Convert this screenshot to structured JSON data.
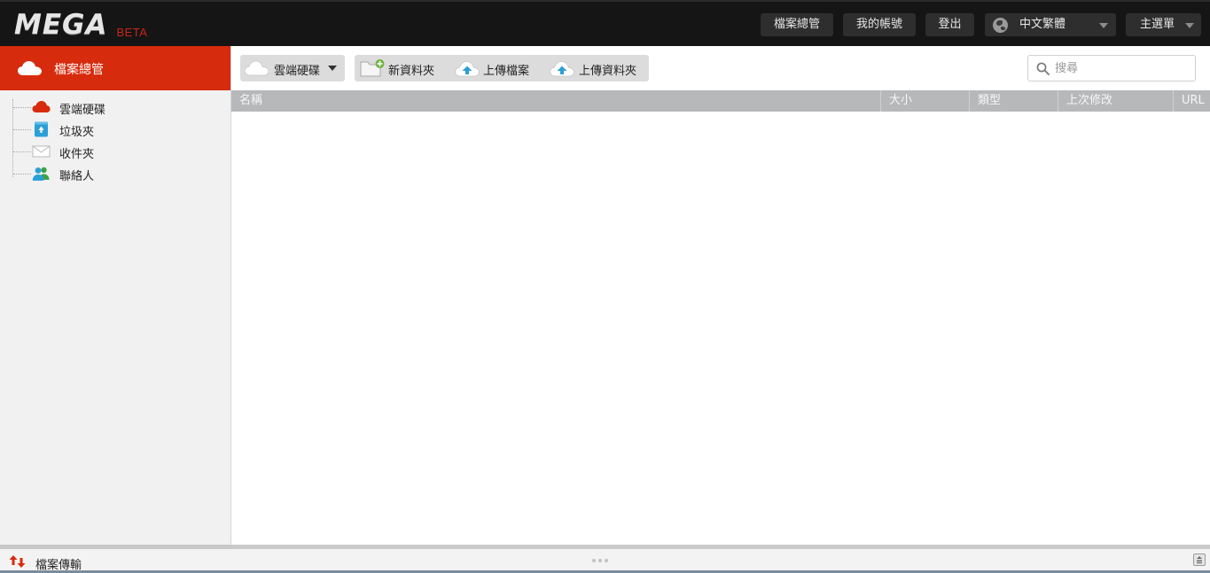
{
  "topbar": {
    "logo_text": "MEGA",
    "beta_label": "BETA",
    "file_manager_label": "檔案總管",
    "my_account_label": "我的帳號",
    "logout_label": "登出",
    "language_label": "中文繁體",
    "main_menu_label": "主選單"
  },
  "sidebar": {
    "header_label": "檔案總管",
    "items": [
      {
        "label": "雲端硬碟",
        "icon": "cloud-drive-icon"
      },
      {
        "label": "垃圾夾",
        "icon": "recycle-bin-icon"
      },
      {
        "label": "收件夾",
        "icon": "inbox-envelope-icon"
      },
      {
        "label": "聯絡人",
        "icon": "contacts-icon"
      }
    ]
  },
  "toolbar": {
    "drive_label": "雲端硬碟",
    "new_folder_label": "新資料夾",
    "upload_file_label": "上傳檔案",
    "upload_folder_label": "上傳資料夾"
  },
  "search": {
    "placeholder": "搜尋"
  },
  "table": {
    "columns": [
      "名稱",
      "大小",
      "類型",
      "上次修改",
      "URL"
    ]
  },
  "transfer_bar": {
    "label": "檔案傳輸"
  },
  "colors": {
    "accent": "#d72b0d",
    "topbar": "#151515",
    "header_gray": "#b6b8ba",
    "upload_blue": "#2b9fd8"
  }
}
